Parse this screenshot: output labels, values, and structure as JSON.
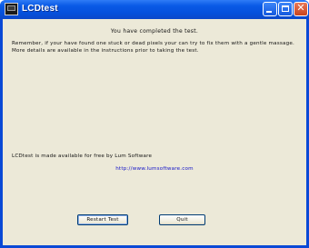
{
  "window": {
    "title": "LCDtest",
    "controls": {
      "minimize_icon": "minimize-icon",
      "maximize_icon": "maximize-icon",
      "close_icon": "close-icon",
      "close_glyph": "✕"
    },
    "accent": "#0a49d6"
  },
  "content": {
    "heading": "You have completed the test.",
    "message": "Remember, if your have found one stuck or dead pixels your can try to fix them with a gentle massage. More details are available in the instructions prior to taking the test.",
    "free_note": "LCDtest is made available for free by Lum Software",
    "link": "http://www.lumsoftware.com",
    "link_color": "#1010c8"
  },
  "buttons": {
    "restart": "Restart Test",
    "quit": "Quit"
  }
}
